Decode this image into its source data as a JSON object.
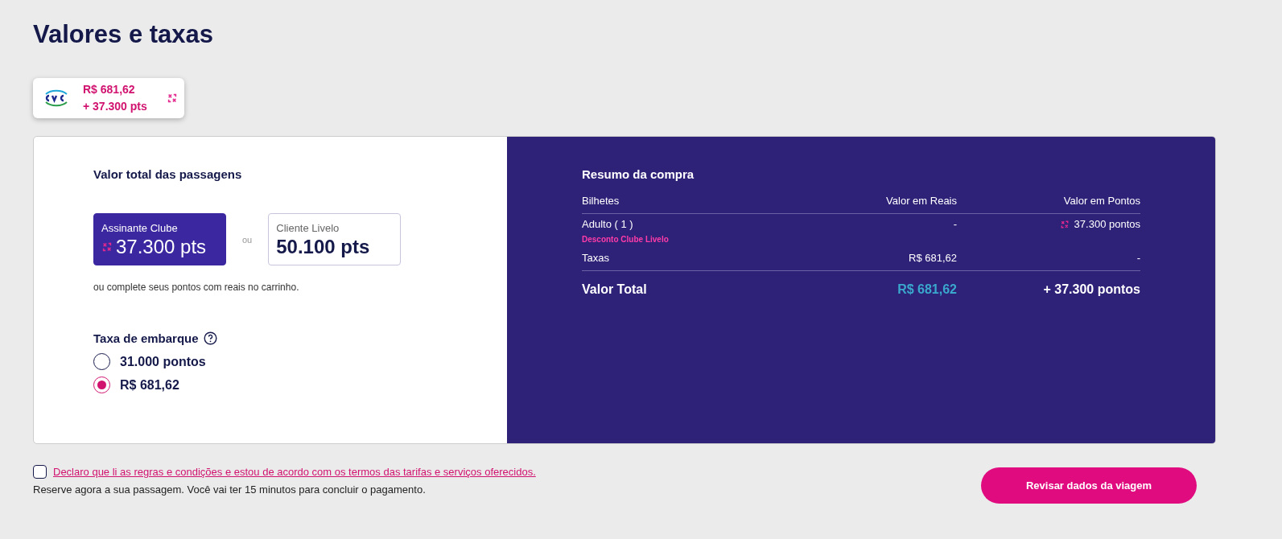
{
  "title": "Valores e taxas",
  "offer": {
    "price": "R$ 681,62",
    "points": "+ 37.300 pts"
  },
  "fare": {
    "heading": "Valor total das passagens",
    "separator": "ou",
    "note": "ou complete seus pontos com reais no carrinho.",
    "options": [
      {
        "label": "Assinante Clube",
        "value": "37.300 pts",
        "selected": true
      },
      {
        "label": "Cliente Livelo",
        "value": "50.100 pts",
        "selected": false
      }
    ]
  },
  "boarding_fee": {
    "heading": "Taxa de embarque",
    "options": [
      {
        "label": "31.000 pontos",
        "selected": false
      },
      {
        "label": "R$ 681,62",
        "selected": true
      }
    ]
  },
  "summary": {
    "title": "Resumo da compra",
    "columns": [
      "Bilhetes",
      "Valor em Reais",
      "Valor em Pontos"
    ],
    "rows": [
      {
        "label": "Adulto ( 1 )",
        "note": "Desconto Clube Livelo",
        "reais": "-",
        "points": "37.300 pontos",
        "points_icon": true
      },
      {
        "label": "Taxas",
        "reais": "R$ 681,62",
        "points": "-",
        "points_icon": false
      }
    ],
    "total": {
      "label": "Valor Total",
      "reais": "R$ 681,62",
      "points": "+ 37.300 pontos"
    }
  },
  "terms": {
    "checked": false,
    "link": "Declaro que li as regras e condições e estou de acordo com os termos das tarifas e serviços oferecidos.",
    "note": "Reserve agora a sua passagem. Você vai ter 15 minutos para concluir o pagamento."
  },
  "button": "Revisar dados da viagem"
}
